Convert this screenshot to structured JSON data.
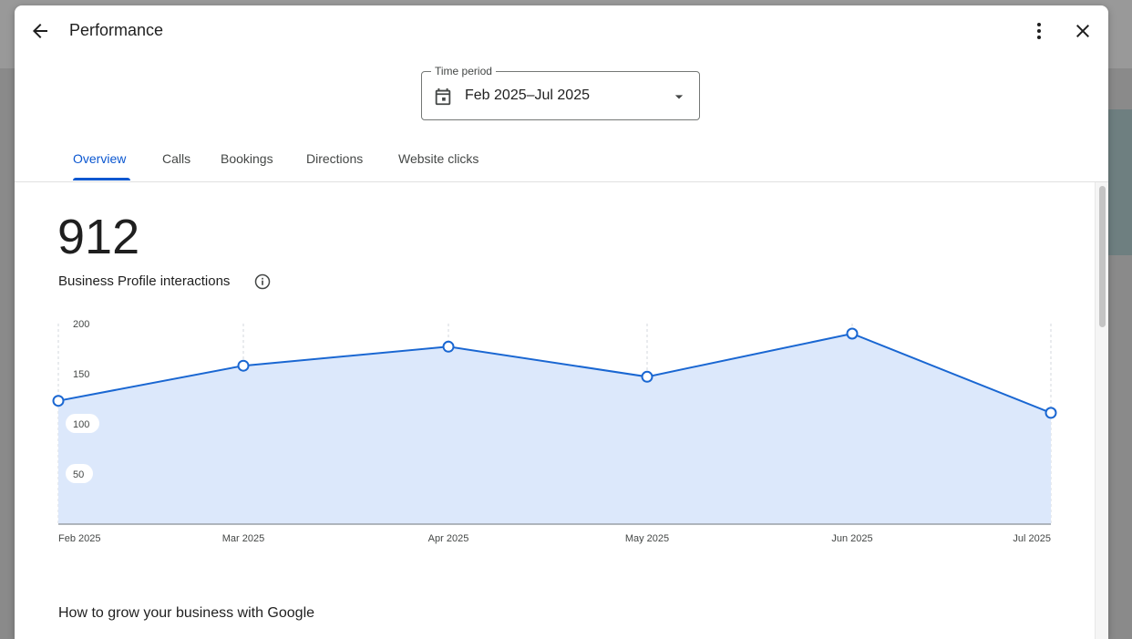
{
  "dialog": {
    "title": "Performance",
    "time_period": {
      "label": "Time period",
      "value": "Feb 2025–Jul 2025"
    },
    "tabs": [
      {
        "label": "Overview",
        "active": true
      },
      {
        "label": "Calls",
        "active": false
      },
      {
        "label": "Bookings",
        "active": false
      },
      {
        "label": "Directions",
        "active": false
      },
      {
        "label": "Website clicks",
        "active": false
      }
    ]
  },
  "metric": {
    "value": "912",
    "label": "Business Profile interactions"
  },
  "section": {
    "heading": "How to grow your business with Google"
  },
  "icons": {
    "back": "arrow-back-icon",
    "more": "more-vert-icon",
    "close": "close-icon",
    "calendar": "calendar-icon",
    "dropdown": "arrow-drop-down-icon",
    "info": "info-icon"
  },
  "colors": {
    "accent": "#0b57d0",
    "line": "#1a67d2",
    "area": "#dce8fb"
  },
  "chart_data": {
    "type": "area",
    "x": [
      "Feb 2025",
      "Mar 2025",
      "Apr 2025",
      "May 2025",
      "Jun 2025",
      "Jul 2025"
    ],
    "series": [
      {
        "values": [
          123,
          158,
          177,
          147,
          190,
          111
        ]
      }
    ],
    "y_ticks": [
      200,
      150,
      100,
      50
    ],
    "ylim": [
      0,
      200
    ],
    "grid": "vertical dashed",
    "legend": "none"
  }
}
